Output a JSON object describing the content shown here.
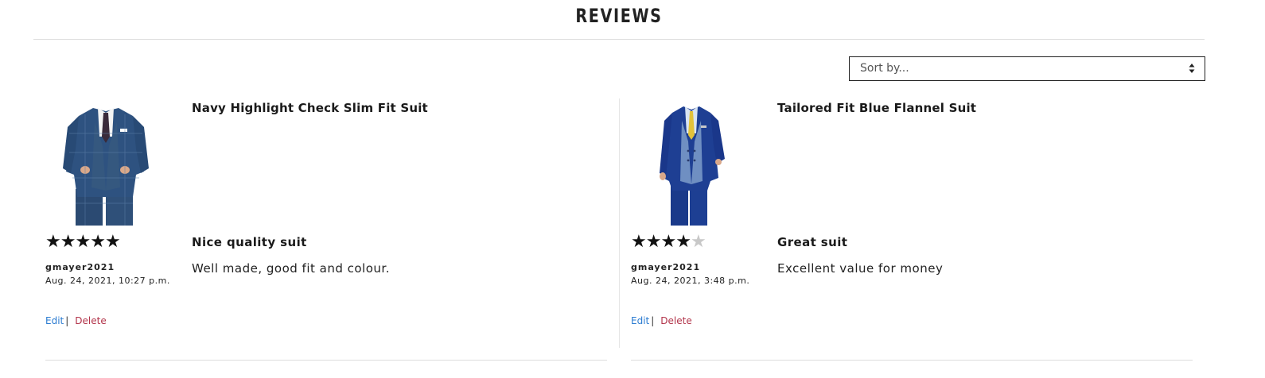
{
  "header": {
    "title": "REVIEWS"
  },
  "sort": {
    "placeholder": "Sort by..."
  },
  "reviews": [
    {
      "product_name": "Navy Highlight Check Slim Fit Suit",
      "product_image": "navy-check-suit-image",
      "rating": 5,
      "stars": [
        "★",
        "★",
        "★",
        "★",
        "★"
      ],
      "reviewer": "gmayer2021",
      "date": "Aug. 24, 2021, 10:27 p.m.",
      "title": "Nice quality suit",
      "body": "Well made, good fit and colour.",
      "edit_label": "Edit",
      "separator": "|",
      "delete_label": "Delete"
    },
    {
      "product_name": "Tailored Fit Blue Flannel Suit",
      "product_image": "blue-flannel-suit-image",
      "rating": 4,
      "stars": [
        "★",
        "★",
        "★",
        "★",
        "★"
      ],
      "reviewer": "gmayer2021",
      "date": "Aug. 24, 2021, 3:48 p.m.",
      "title": "Great suit",
      "body": "Excellent value for money",
      "edit_label": "Edit",
      "separator": "|",
      "delete_label": "Delete"
    }
  ],
  "colors": {
    "edit_link": "#2a7bd1",
    "delete_link": "#b2344a",
    "star_filled": "#111111",
    "star_empty": "#c8c8c8",
    "navy_suit": "#2b4a72",
    "royal_suit": "#1e3f93",
    "yellow_tie": "#e3c23a"
  }
}
